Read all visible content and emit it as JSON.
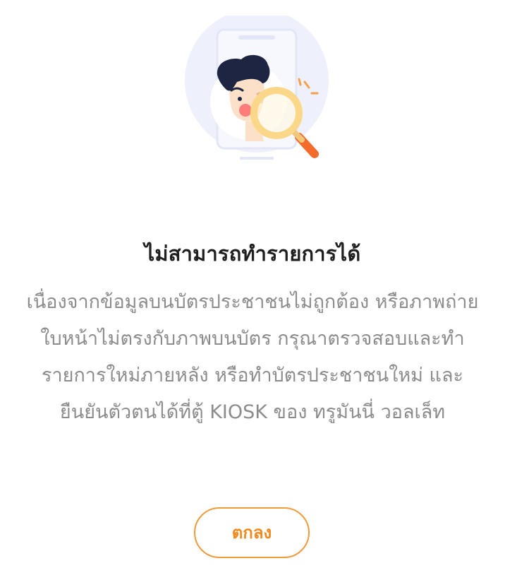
{
  "dialog": {
    "title": "ไม่สามารถทำรายการได้",
    "message": "เนื่องจากข้อมูลบนบัตรประชาชนไม่ถูกต้อง หรือภาพถ่ายใบหน้าไม่ตรงกับภาพบนบัตร กรุณาตรวจสอบและทำรายการใหม่ภายหลัง หรือทำบัตรประชาชนใหม่ และยืนยันตัวตนได้ที่ตู้ KIOSK ของ ทรูมันนี่ วอลเล็ท",
    "ok_label": "ตกลง"
  },
  "illustration": {
    "icon": "face-verification-magnifier-icon"
  },
  "colors": {
    "accent": "#f28a1e",
    "title": "#1f1f1f",
    "body_text": "#8c8c8c",
    "illustration_bg": "#eef0fb"
  }
}
